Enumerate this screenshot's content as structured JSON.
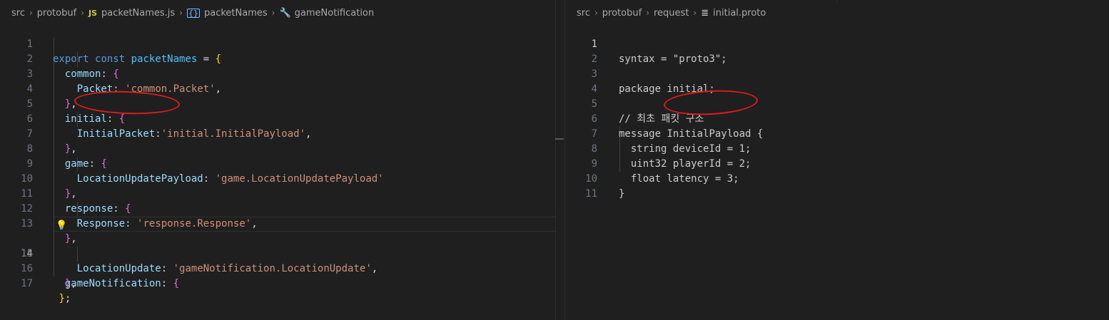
{
  "left": {
    "breadcrumb": {
      "items": [
        "src",
        "protobuf",
        "packetNames.js",
        "packetNames",
        "gameNotification"
      ],
      "js_badge": "JS"
    },
    "line_numbers": [
      "1",
      "2",
      "3",
      "4",
      "5",
      "6",
      "7",
      "8",
      "9",
      "10",
      "11",
      "12",
      "13",
      "14",
      "15",
      "16",
      "17"
    ],
    "lines": {
      "l1": {
        "kw1": "export",
        "kw2": "const",
        "name": "packetNames",
        "eq": "=",
        "brace": "{"
      },
      "l2": {
        "key": "common",
        "colon": ":",
        "brace": "{"
      },
      "l3": {
        "key": "Packet",
        "colon": ":",
        "value": "'common.Packet'",
        "comma": ","
      },
      "l4": {
        "close": "}",
        "comma": ","
      },
      "l5": {
        "key": "initial",
        "colon": ":",
        "brace": "{"
      },
      "l6": {
        "key": "InitialPacket",
        "colon": ":",
        "value": "'initial.InitialPayload'",
        "comma": ","
      },
      "l7": {
        "close": "}",
        "comma": ","
      },
      "l8": {
        "key": "game",
        "colon": ":",
        "brace": "{"
      },
      "l9": {
        "key": "LocationUpdatePayload",
        "colon": ":",
        "value": "'game.LocationUpdatePayload'"
      },
      "l10": {
        "close": "}",
        "comma": ","
      },
      "l11": {
        "key": "response",
        "colon": ":",
        "brace": "{"
      },
      "l12": {
        "key": "Response",
        "colon": ":",
        "value": "'response.Response'",
        "comma": ","
      },
      "l13": {
        "close": "}",
        "comma": ","
      },
      "l14": {
        "key": "gameNotification",
        "colon": ":",
        "brace": "{"
      },
      "l15": {
        "key": "LocationUpdate",
        "colon": ":",
        "value": "'gameNotification.LocationUpdate'",
        "comma": ","
      },
      "l16": {
        "close": "}",
        "comma": ","
      },
      "l17": {
        "close": "}",
        "semi": ";"
      }
    }
  },
  "right": {
    "breadcrumb": {
      "items": [
        "src",
        "protobuf",
        "request",
        "initial.proto"
      ]
    },
    "line_numbers": [
      "1",
      "2",
      "3",
      "4",
      "5",
      "6",
      "7",
      "8",
      "9",
      "10",
      "11"
    ],
    "lines": {
      "l1": "syntax = \"proto3\";",
      "l3": "package initial;",
      "l5": "// 최초 패킷 구조",
      "l6a": "message ",
      "l6b": "InitialPayload",
      "l6c": " {",
      "l7": "  string deviceId = 1;",
      "l8": "  uint32 playerId = 2;",
      "l9": "  float latency = 3;",
      "l10": "}"
    }
  },
  "colors": {
    "background": "#1f1f1f",
    "keyword": "#569cd6",
    "property": "#9cdcfe",
    "string": "#ce9178",
    "annotation": "#e01b1b"
  }
}
